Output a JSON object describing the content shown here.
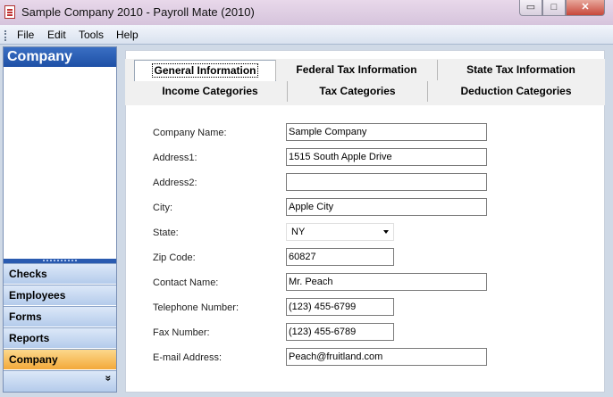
{
  "window": {
    "title": "Sample Company 2010 - Payroll Mate (2010)",
    "min_glyph": "▭",
    "max_glyph": "□",
    "close_glyph": "✕",
    "app_icon": "document-icon"
  },
  "menu": {
    "items": [
      "File",
      "Edit",
      "Tools",
      "Help"
    ]
  },
  "sidebar": {
    "header": "Company",
    "nav": [
      "Checks",
      "Employees",
      "Forms",
      "Reports",
      "Company"
    ],
    "active": "Company",
    "chevron": "»"
  },
  "tabs": {
    "row1": [
      "General Information",
      "Federal Tax Information",
      "State Tax Information"
    ],
    "row2": [
      "Income Categories",
      "Tax Categories",
      "Deduction Categories"
    ],
    "selected": "General Information"
  },
  "form": {
    "fields": [
      {
        "label": "Company Name:",
        "value": "Sample Company"
      },
      {
        "label": "Address1:",
        "value": "1515 South Apple Drive"
      },
      {
        "label": "Address2:",
        "value": ""
      },
      {
        "label": "City:",
        "value": "Apple City"
      },
      {
        "label": "State:",
        "value": "NY"
      },
      {
        "label": "Zip Code:",
        "value": "60827"
      },
      {
        "label": "Contact Name:",
        "value": "Mr. Peach"
      },
      {
        "label": "Telephone Number:",
        "value": "(123) 455-6799"
      },
      {
        "label": "Fax Number:",
        "value": "(123) 455-6789"
      },
      {
        "label": "E-mail Address:",
        "value": "Peach@fruitland.com"
      }
    ]
  }
}
